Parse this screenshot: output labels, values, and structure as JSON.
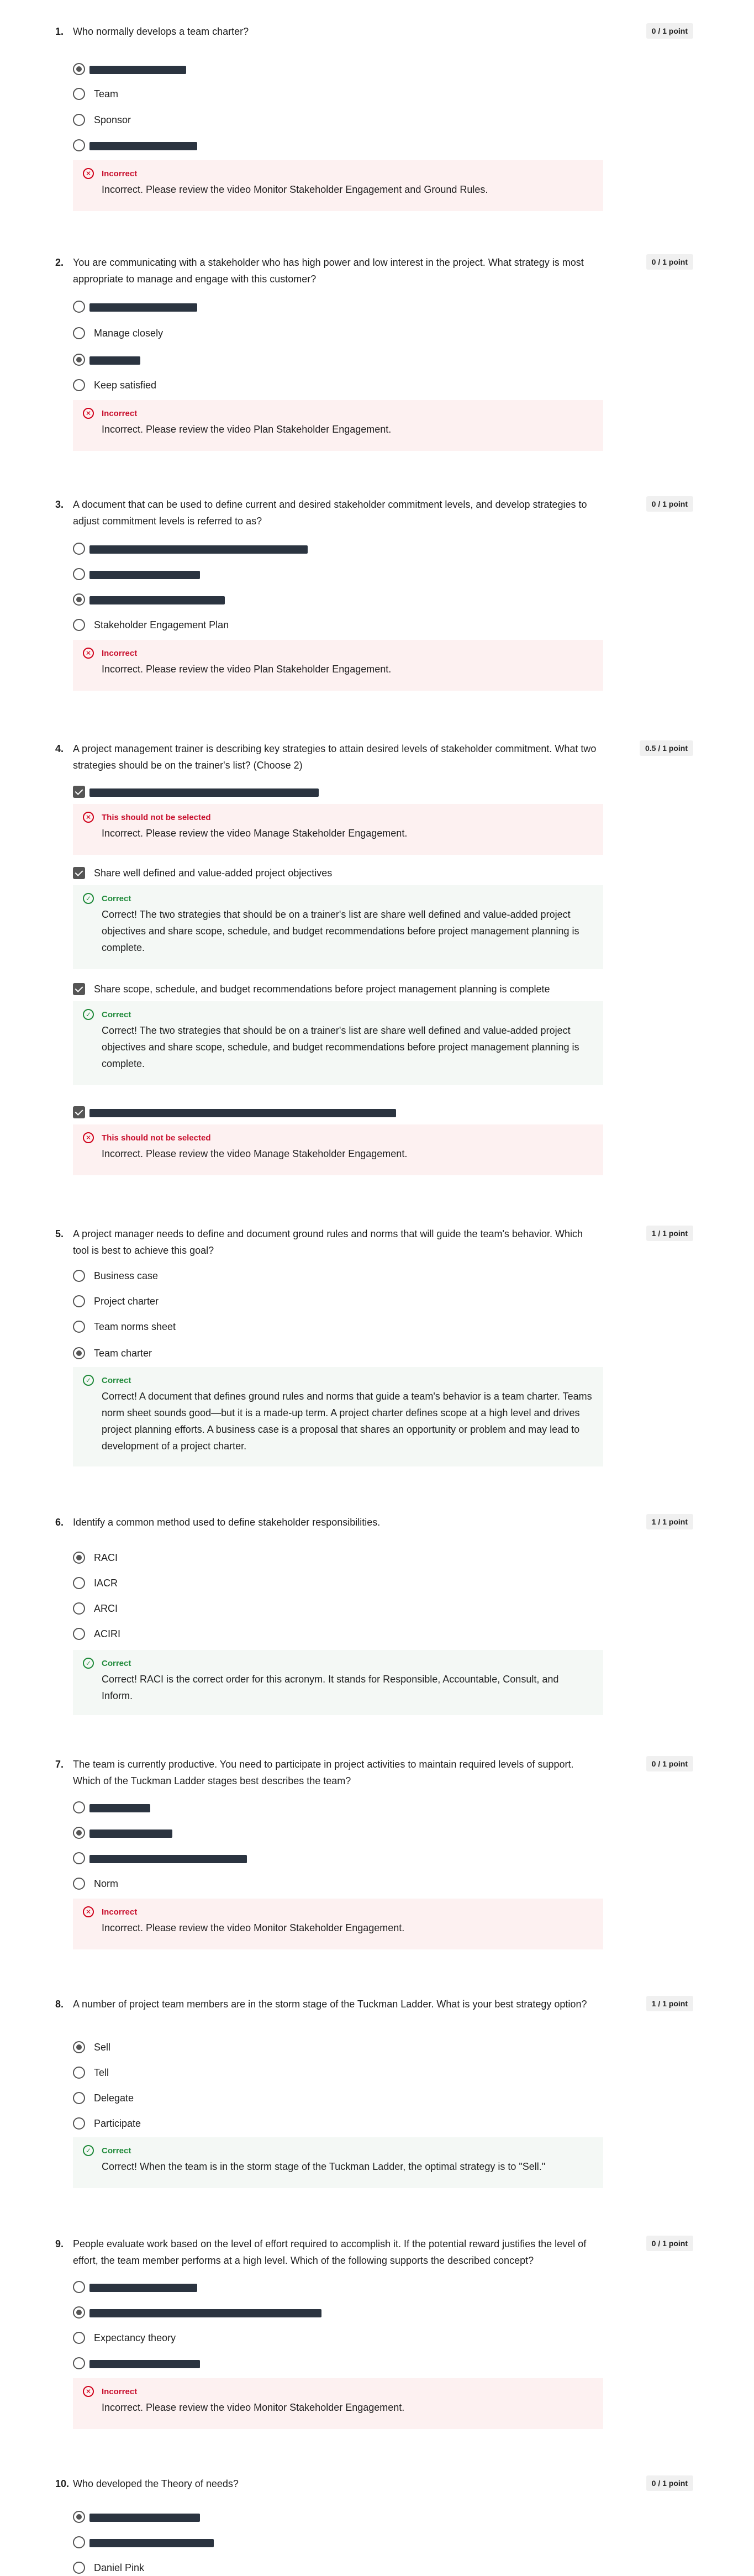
{
  "questions": [
    {
      "number": "1.",
      "text": "Who normally develops a team charter?",
      "score": "0 / 1 point",
      "options": [
        {
          "label": "",
          "selected": true,
          "redacted": true
        },
        {
          "label": "Team",
          "selected": false,
          "redacted": false
        },
        {
          "label": "Sponsor",
          "selected": false,
          "redacted": false
        },
        {
          "label": "",
          "selected": false,
          "redacted": true
        }
      ],
      "feedback": [
        {
          "type": "incorrect",
          "title": "Incorrect",
          "message": "Incorrect. Please review the video Monitor Stakeholder Engagement and Ground Rules."
        }
      ]
    },
    {
      "number": "2.",
      "text": "You are communicating with a stakeholder who has high power and low interest in the project. What strategy is most appropriate to manage and engage with this customer?",
      "score": "0 / 1 point",
      "options": [
        {
          "label": "",
          "selected": false,
          "redacted": true
        },
        {
          "label": "Manage closely",
          "selected": false,
          "redacted": false
        },
        {
          "label": "",
          "selected": true,
          "redacted": true
        },
        {
          "label": "Keep satisfied",
          "selected": false,
          "redacted": false
        }
      ],
      "feedback": [
        {
          "type": "incorrect",
          "title": "Incorrect",
          "message": "Incorrect. Please review the video Plan Stakeholder Engagement."
        }
      ]
    },
    {
      "number": "3.",
      "text": "A document that can be used to define current and desired stakeholder commitment levels, and develop strategies to adjust commitment levels is referred to as?",
      "score": "0 / 1 point",
      "options": [
        {
          "label": "",
          "selected": false,
          "redacted": true
        },
        {
          "label": "",
          "selected": false,
          "redacted": true
        },
        {
          "label": "",
          "selected": true,
          "redacted": true
        },
        {
          "label": "Stakeholder Engagement Plan",
          "selected": false,
          "redacted": false
        }
      ],
      "feedback": [
        {
          "type": "incorrect",
          "title": "Incorrect",
          "message": "Incorrect. Please review the video Plan Stakeholder Engagement."
        }
      ]
    },
    {
      "number": "4.",
      "text": "A project management trainer is describing key strategies to attain desired levels of stakeholder commitment. What two strategies should be on the trainer's list? (Choose 2)",
      "score": "0.5 / 1 point",
      "multi": [
        {
          "label": "",
          "redacted": true,
          "feedback": {
            "type": "incorrect",
            "title": "This should not be selected",
            "message": "Incorrect. Please review the video Manage Stakeholder Engagement."
          }
        },
        {
          "label": "Share well defined and value-added project objectives",
          "redacted": false,
          "feedback": {
            "type": "correct",
            "title": "Correct",
            "message": "Correct! The two strategies that should be on a trainer's list are share well defined and value-added project objectives and share scope, schedule, and budget recommendations before project management planning is complete."
          }
        },
        {
          "label": "Share scope, schedule, and budget recommendations before project management planning is complete",
          "redacted": false,
          "feedback": {
            "type": "correct",
            "title": "Correct",
            "message": "Correct! The two strategies that should be on a trainer's list are share well defined and value-added project objectives and share scope, schedule, and budget recommendations before project management planning is complete."
          }
        },
        {
          "label": "",
          "redacted": true,
          "feedback": {
            "type": "incorrect",
            "title": "This should not be selected",
            "message": "Incorrect. Please review the video Manage Stakeholder Engagement."
          }
        }
      ]
    },
    {
      "number": "5.",
      "text": "A project manager needs to define and document ground rules and norms that will guide the team's behavior. Which tool is best to achieve this goal?",
      "score": "1 / 1 point",
      "options": [
        {
          "label": "Business case",
          "selected": false,
          "redacted": false
        },
        {
          "label": "Project charter",
          "selected": false,
          "redacted": false
        },
        {
          "label": "Team norms sheet",
          "selected": false,
          "redacted": false
        },
        {
          "label": "Team charter",
          "selected": true,
          "redacted": false
        }
      ],
      "feedback": [
        {
          "type": "correct",
          "title": "Correct",
          "message": "Correct! A document that defines ground rules and norms that guide a team's behavior is a team charter. Teams norm sheet sounds good—but it is a made-up term. A project charter defines scope at a high level and drives project planning efforts. A business case is a proposal that shares an opportunity or problem and may lead to development of a project charter."
        }
      ]
    },
    {
      "number": "6.",
      "text": "Identify a common method used to define stakeholder responsibilities.",
      "score": "1 / 1 point",
      "options": [
        {
          "label": "RACI",
          "selected": true,
          "redacted": false
        },
        {
          "label": "IACR",
          "selected": false,
          "redacted": false
        },
        {
          "label": "ARCI",
          "selected": false,
          "redacted": false
        },
        {
          "label": "ACIRI",
          "selected": false,
          "redacted": false
        }
      ],
      "feedback": [
        {
          "type": "correct",
          "title": "Correct",
          "message": "Correct! RACI is the correct order for this acronym. It stands for Responsible, Accountable, Consult, and Inform."
        }
      ]
    },
    {
      "number": "7.",
      "text": "The team is currently productive. You need to participate in project activities to maintain required levels of support. Which of the Tuckman Ladder stages best describes the team?",
      "score": "0 / 1 point",
      "options": [
        {
          "label": "",
          "selected": false,
          "redacted": true
        },
        {
          "label": "",
          "selected": true,
          "redacted": true
        },
        {
          "label": "",
          "selected": false,
          "redacted": true
        },
        {
          "label": "Norm",
          "selected": false,
          "redacted": false
        }
      ],
      "feedback": [
        {
          "type": "incorrect",
          "title": "Incorrect",
          "message": "Incorrect. Please review the video Monitor Stakeholder Engagement."
        }
      ]
    },
    {
      "number": "8.",
      "text": "A number of project team members are in the storm stage of the Tuckman Ladder. What is your best strategy option?",
      "score": "1 / 1 point",
      "options": [
        {
          "label": "Sell",
          "selected": true,
          "redacted": false
        },
        {
          "label": "Tell",
          "selected": false,
          "redacted": false
        },
        {
          "label": "Delegate",
          "selected": false,
          "redacted": false
        },
        {
          "label": "Participate",
          "selected": false,
          "redacted": false
        }
      ],
      "feedback": [
        {
          "type": "correct",
          "title": "Correct",
          "message": "Correct! When the team is in the storm stage of the Tuckman Ladder, the optimal strategy is to \"Sell.\""
        }
      ]
    },
    {
      "number": "9.",
      "text": "People evaluate work based on the level of effort required to accomplish it. If the potential reward justifies the level of effort, the team member performs at a high level. Which of the following supports the described concept?",
      "score": "0 / 1 point",
      "options": [
        {
          "label": "",
          "selected": false,
          "redacted": true
        },
        {
          "label": "",
          "selected": true,
          "redacted": true
        },
        {
          "label": "Expectancy theory",
          "selected": false,
          "redacted": false
        },
        {
          "label": "",
          "selected": false,
          "redacted": true
        }
      ],
      "feedback": [
        {
          "type": "incorrect",
          "title": "Incorrect",
          "message": "Incorrect. Please review the video Monitor Stakeholder Engagement."
        }
      ]
    },
    {
      "number": "10.",
      "text": "Who developed the Theory of needs?",
      "score": "0 / 1 point",
      "options": [
        {
          "label": "",
          "selected": true,
          "redacted": true
        },
        {
          "label": "",
          "selected": false,
          "redacted": true
        },
        {
          "label": "Daniel Pink",
          "selected": false,
          "redacted": false
        }
      ],
      "feedback": []
    }
  ]
}
